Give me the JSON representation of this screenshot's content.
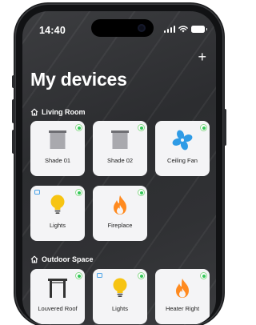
{
  "status_bar": {
    "time": "14:40"
  },
  "header": {
    "title": "My devices",
    "add_label": "+"
  },
  "sections": [
    {
      "title": "Living Room",
      "devices": [
        {
          "label": "Shade 01",
          "icon": "shade-icon",
          "status": "on"
        },
        {
          "label": "Shade 02",
          "icon": "shade-icon",
          "status": "on"
        },
        {
          "label": "Ceiling Fan",
          "icon": "fan-icon",
          "status": "on"
        },
        {
          "label": "Lights",
          "icon": "lightbulb-icon",
          "status": "on"
        },
        {
          "label": "Fireplace",
          "icon": "flame-icon",
          "status": "on"
        }
      ]
    },
    {
      "title": "Outdoor Space",
      "devices": [
        {
          "label": "Louvered Roof",
          "icon": "pergola-icon",
          "status": "on"
        },
        {
          "label": "Lights",
          "icon": "lightbulb-icon",
          "status": "on"
        },
        {
          "label": "Heater Right",
          "icon": "flame-icon",
          "status": "on"
        }
      ]
    }
  ],
  "colors": {
    "status_on": "#34c759",
    "fan": "#2f9be6",
    "bulb": "#f7c412",
    "flame": "#ff8a1f",
    "shade": "#a9a9ae"
  }
}
